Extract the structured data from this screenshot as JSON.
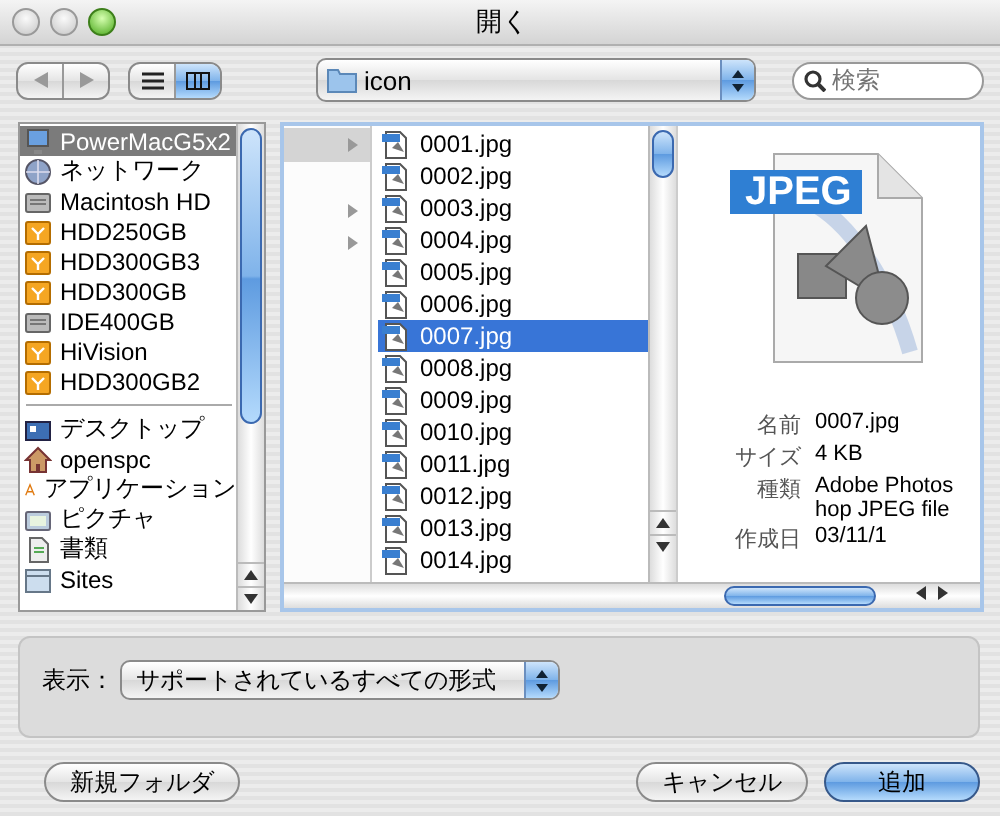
{
  "window": {
    "title": "開く"
  },
  "toolbar": {
    "views": [
      {
        "kind": "list",
        "selected": false
      },
      {
        "kind": "columns",
        "selected": true
      }
    ],
    "path": "icon",
    "search": {
      "placeholder": "検索"
    }
  },
  "sidebar": {
    "devices": [
      {
        "label": "PowerMacG5x2",
        "kind": "computer",
        "selected": true
      },
      {
        "label": "ネットワーク",
        "kind": "network",
        "selected": false
      },
      {
        "label": "Macintosh HD",
        "kind": "disk",
        "selected": false
      },
      {
        "label": "HDD250GB",
        "kind": "external",
        "selected": false
      },
      {
        "label": "HDD300GB3",
        "kind": "external",
        "selected": false
      },
      {
        "label": "HDD300GB",
        "kind": "external",
        "selected": false
      },
      {
        "label": "IDE400GB",
        "kind": "disk",
        "selected": false
      },
      {
        "label": "HiVision",
        "kind": "external",
        "selected": false
      },
      {
        "label": "HDD300GB2",
        "kind": "external",
        "selected": false
      }
    ],
    "places": [
      {
        "label": "デスクトップ",
        "kind": "desktop",
        "selected": false
      },
      {
        "label": "openspc",
        "kind": "home",
        "selected": false
      },
      {
        "label": "アプリケーション",
        "kind": "apps",
        "selected": false
      },
      {
        "label": "ピクチャ",
        "kind": "pictures",
        "selected": false
      },
      {
        "label": "書類",
        "kind": "documents",
        "selected": false
      },
      {
        "label": "Sites",
        "kind": "sites",
        "selected": false
      }
    ]
  },
  "parent_column": [
    {
      "selected": true,
      "expandable": true
    },
    {
      "selected": false,
      "expandable": false
    },
    {
      "selected": false,
      "expandable": true
    },
    {
      "selected": false,
      "expandable": true
    }
  ],
  "files": [
    {
      "name": "0001.jpg",
      "selected": false
    },
    {
      "name": "0002.jpg",
      "selected": false
    },
    {
      "name": "0003.jpg",
      "selected": false
    },
    {
      "name": "0004.jpg",
      "selected": false
    },
    {
      "name": "0005.jpg",
      "selected": false
    },
    {
      "name": "0006.jpg",
      "selected": false
    },
    {
      "name": "0007.jpg",
      "selected": true
    },
    {
      "name": "0008.jpg",
      "selected": false
    },
    {
      "name": "0009.jpg",
      "selected": false
    },
    {
      "name": "0010.jpg",
      "selected": false
    },
    {
      "name": "0011.jpg",
      "selected": false
    },
    {
      "name": "0012.jpg",
      "selected": false
    },
    {
      "name": "0013.jpg",
      "selected": false
    },
    {
      "name": "0014.jpg",
      "selected": false
    }
  ],
  "preview": {
    "badge": "JPEG",
    "info": [
      {
        "label": "名前",
        "value": "0007.jpg"
      },
      {
        "label": "サイズ",
        "value": "4 KB"
      },
      {
        "label": "種類",
        "value": "Adobe Photoshop JPEG file"
      },
      {
        "label": "作成日",
        "value": "03/11/1"
      }
    ]
  },
  "filter": {
    "label": "表示：",
    "value": "サポートされているすべての形式"
  },
  "buttons": [
    {
      "label": "新規フォルダ",
      "default": false
    },
    {
      "label": "キャンセル",
      "default": false
    },
    {
      "label": "追加",
      "default": true
    }
  ]
}
